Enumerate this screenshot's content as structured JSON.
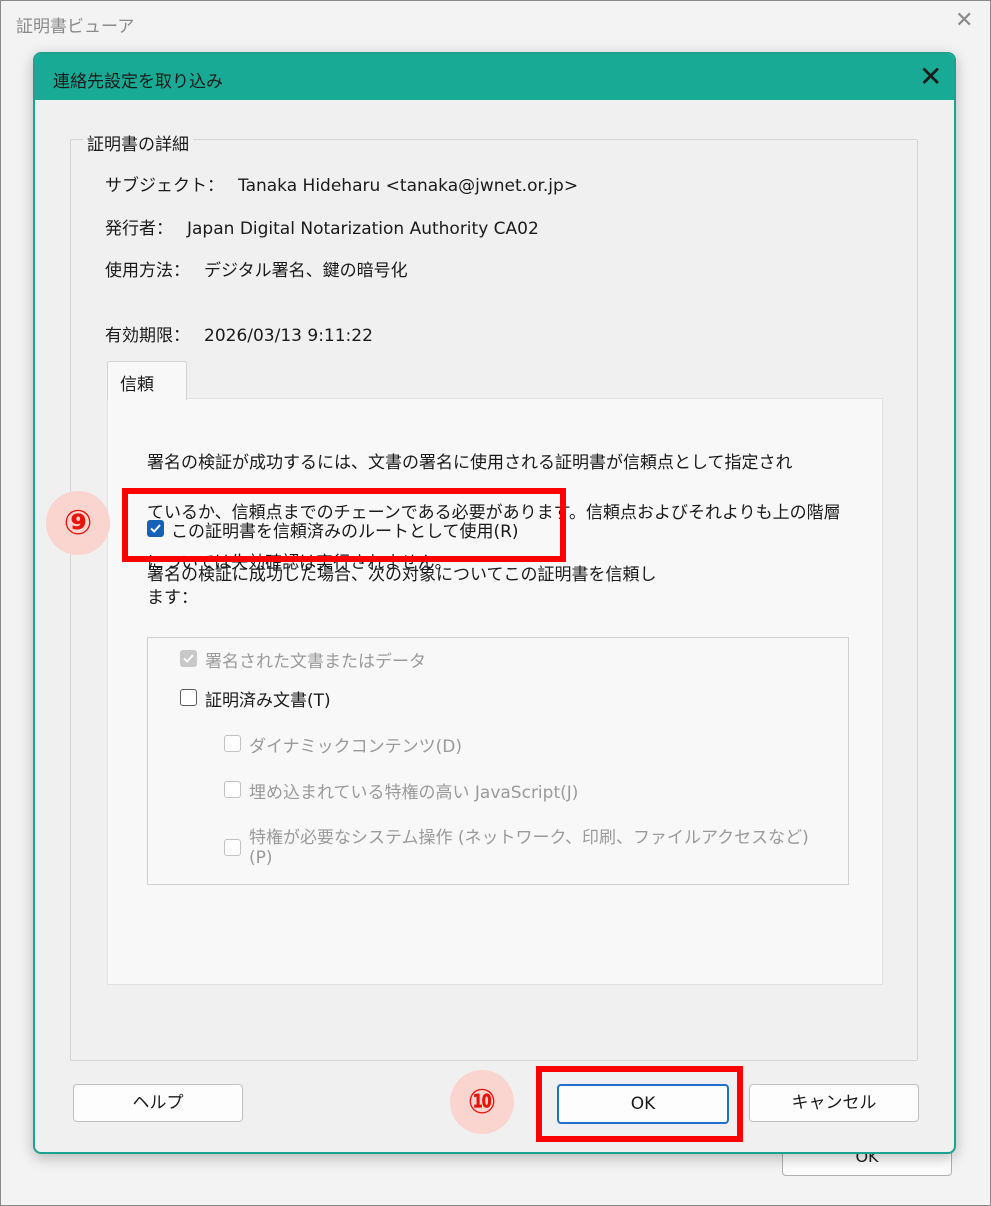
{
  "outer_window": {
    "title": "証明書ビューア",
    "close_glyph": "✕",
    "ok_label": "OK"
  },
  "dialog": {
    "title": "連絡先設定を取り込み",
    "close_glyph": "✕",
    "accent_color": "#18aa94"
  },
  "details": {
    "legend": "証明書の詳細",
    "subject_label": "サブジェクト：",
    "subject_value": "Tanaka Hideharu <tanaka@jwnet.or.jp>",
    "issuer_label": "発行者：",
    "issuer_value": "Japan Digital Notarization Authority CA02",
    "usage_label": "使用方法：",
    "usage_value": "デジタル署名、鍵の暗号化",
    "expiry_label": "有効期限：",
    "expiry_value": "2026/03/13 9:11:22"
  },
  "tabs": [
    {
      "label": "信頼",
      "selected": true
    }
  ],
  "trust": {
    "description_line1": "署名の検証が成功するには、文書の署名に使用される証明書が信頼点として指定され",
    "description_line2": "ているか、信頼点までのチェーンである必要があります。信頼点およびそれよりも上の階層",
    "description_line3": "については失効確認は実行されません。",
    "use_as_root_label": "この証明書を信頼済みのルートとして使用(R)",
    "use_as_root_checked": true,
    "subtext_line1": "署名の検証に成功した場合、次の対象についてこの証明書を信頼し",
    "subtext_line2": "ます：",
    "options": [
      {
        "label": "署名された文書またはデータ",
        "checked": true,
        "enabled": false
      },
      {
        "label": "証明済み文書(T)",
        "checked": false,
        "enabled": true
      },
      {
        "label": "ダイナミックコンテンツ(D)",
        "checked": false,
        "enabled": false
      },
      {
        "label": "埋め込まれている特権の高い JavaScript(J)",
        "checked": false,
        "enabled": false
      },
      {
        "label": "特権が必要なシステム操作 (ネットワーク、印刷、ファイルアクセスなど)",
        "label_line2": "(P)",
        "checked": false,
        "enabled": false
      }
    ]
  },
  "buttons": {
    "help": "ヘルプ",
    "ok": "OK",
    "cancel": "キャンセル"
  },
  "annotations": {
    "step9": "⑨",
    "step10": "⑩",
    "highlight_color": "#ff0000"
  }
}
